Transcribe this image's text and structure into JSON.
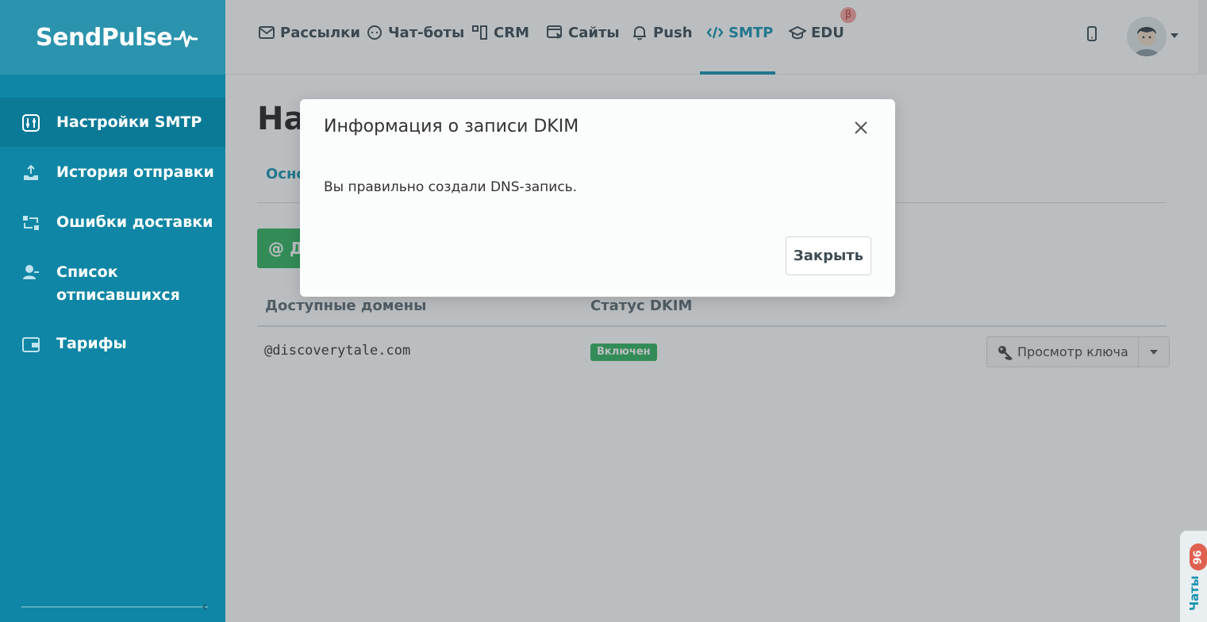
{
  "brand": {
    "logo_text": "SendPulse"
  },
  "sidebar": {
    "items": [
      {
        "label": "Настройки SMTP",
        "icon": "sliders-icon",
        "active": true
      },
      {
        "label": "История отправки",
        "icon": "upload-tray-icon"
      },
      {
        "label": "Ошибки доставки",
        "icon": "bounce-icon"
      },
      {
        "label": "Список отписавшихся",
        "icon": "user-minus-icon"
      },
      {
        "label": "Тарифы",
        "icon": "wallet-icon"
      }
    ]
  },
  "topnav": {
    "items": [
      {
        "label": "Рассылки",
        "icon": "envelope-icon"
      },
      {
        "label": "Чат-боты",
        "icon": "chat-bubble-icon"
      },
      {
        "label": "CRM",
        "icon": "kanban-icon"
      },
      {
        "label": "Сайты",
        "icon": "browser-cursor-icon"
      },
      {
        "label": "Push",
        "icon": "bell-icon"
      },
      {
        "label": "SMTP",
        "icon": "code-icon",
        "active": true
      },
      {
        "label": "EDU",
        "icon": "graduation-cap-icon"
      }
    ],
    "beta_badge": "β",
    "accent_color": "#1592b1"
  },
  "main": {
    "page_title": "На",
    "tab_label": "Осно",
    "add_button_label": "@ Д",
    "table": {
      "headers": [
        "Доступные домены",
        "Статус DKIM"
      ],
      "rows": [
        {
          "domain": "@discoverytale.com",
          "status": "Включен",
          "action": "Просмотр ключа"
        }
      ]
    }
  },
  "chat_widget": {
    "label": "Чаты",
    "count": "96"
  },
  "modal": {
    "title": "Информация о записи DKIM",
    "body": "Вы правильно создали DNS-запись.",
    "close_button_label": "Закрыть"
  }
}
